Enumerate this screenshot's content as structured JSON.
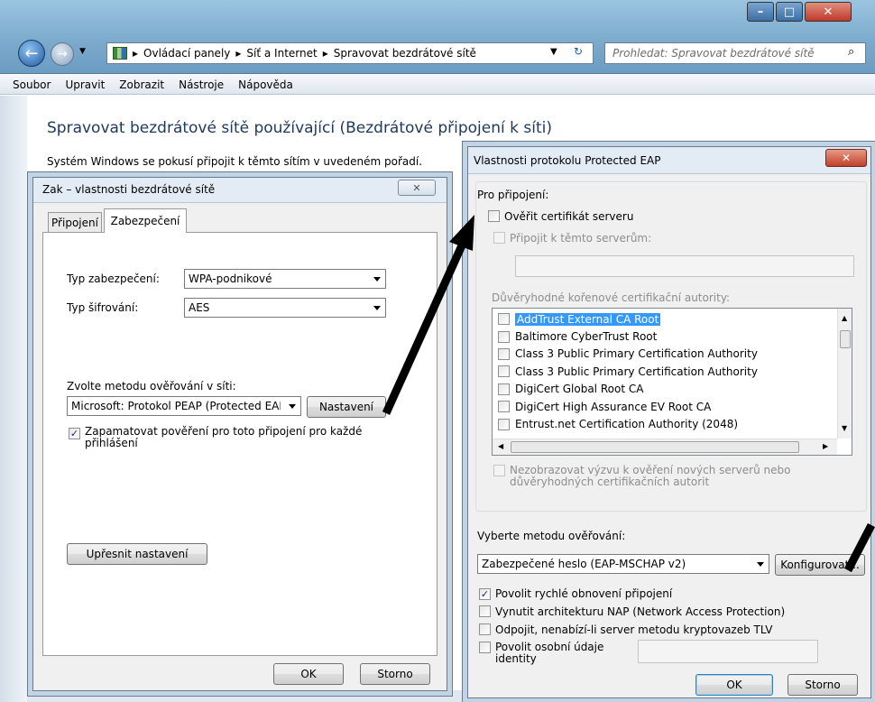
{
  "explorer": {
    "breadcrumb": [
      "Ovládací panely",
      "Síť a Internet",
      "Spravovat bezdrátové sítě"
    ],
    "search_placeholder": "Prohledat: Spravovat bezdrátové sítě",
    "menu": [
      "Soubor",
      "Upravit",
      "Zobrazit",
      "Nástroje",
      "Nápověda"
    ],
    "heading": "Spravovat bezdrátové sítě používající (Bezdrátové připojení k síti)",
    "description": "Systém Windows se pokusí připojit k těmto sítím v uvedeném pořadí."
  },
  "zak": {
    "title": "Zak – vlastnosti bezdrátové sítě",
    "tabs": [
      "Připojení",
      "Zabezpečení"
    ],
    "security_type_label": "Typ zabezpečení:",
    "security_type_value": "WPA-podnikové",
    "encryption_label": "Typ šifrování:",
    "encryption_value": "AES",
    "auth_method_label": "Zvolte metodu ověřování v síti:",
    "auth_method_value": "Microsoft: Protokol PEAP (Protected EAP",
    "settings_button": "Nastavení",
    "remember_label": "Zapamatovat pověření pro toto připojení pro každé přihlášení",
    "advanced_button": "Upřesnit nastavení",
    "ok": "OK",
    "cancel": "Storno"
  },
  "peap": {
    "title": "Vlastnosti protokolu Protected EAP",
    "connect_label": "Pro připojení:",
    "verify_cert": "Ověřit certifikát serveru",
    "connect_servers": "Připojit k těmto serverům:",
    "trusted_ca_label": "Důvěryhodné kořenové certifikační autority:",
    "ca_list": [
      "AddTrust External CA Root",
      "Baltimore CyberTrust Root",
      "Class 3 Public Primary Certification Authority",
      "Class 3 Public Primary Certification Authority",
      "DigiCert Global Root CA",
      "DigiCert High Assurance EV Root CA",
      "Entrust.net Certification Authority (2048)"
    ],
    "no_prompt": "Nezobrazovat výzvu k ověření nových serverů nebo důvěryhodných certifikačních autorit",
    "select_method": "Vyberte metodu ověřování:",
    "method_value": "Zabezpečené heslo (EAP-MSCHAP v2)",
    "configure_button": "Konfigurovat...",
    "fast_reconnect": "Povolit rychlé obnovení připojení",
    "nap": "Vynutit architekturu NAP (Network Access Protection)",
    "disconnect": "Odpojit, nenabízí-li server metodu kryptovazeb TLV",
    "identity_privacy": "Povolit osobní údaje identity",
    "ok": "OK",
    "cancel": "Storno"
  }
}
